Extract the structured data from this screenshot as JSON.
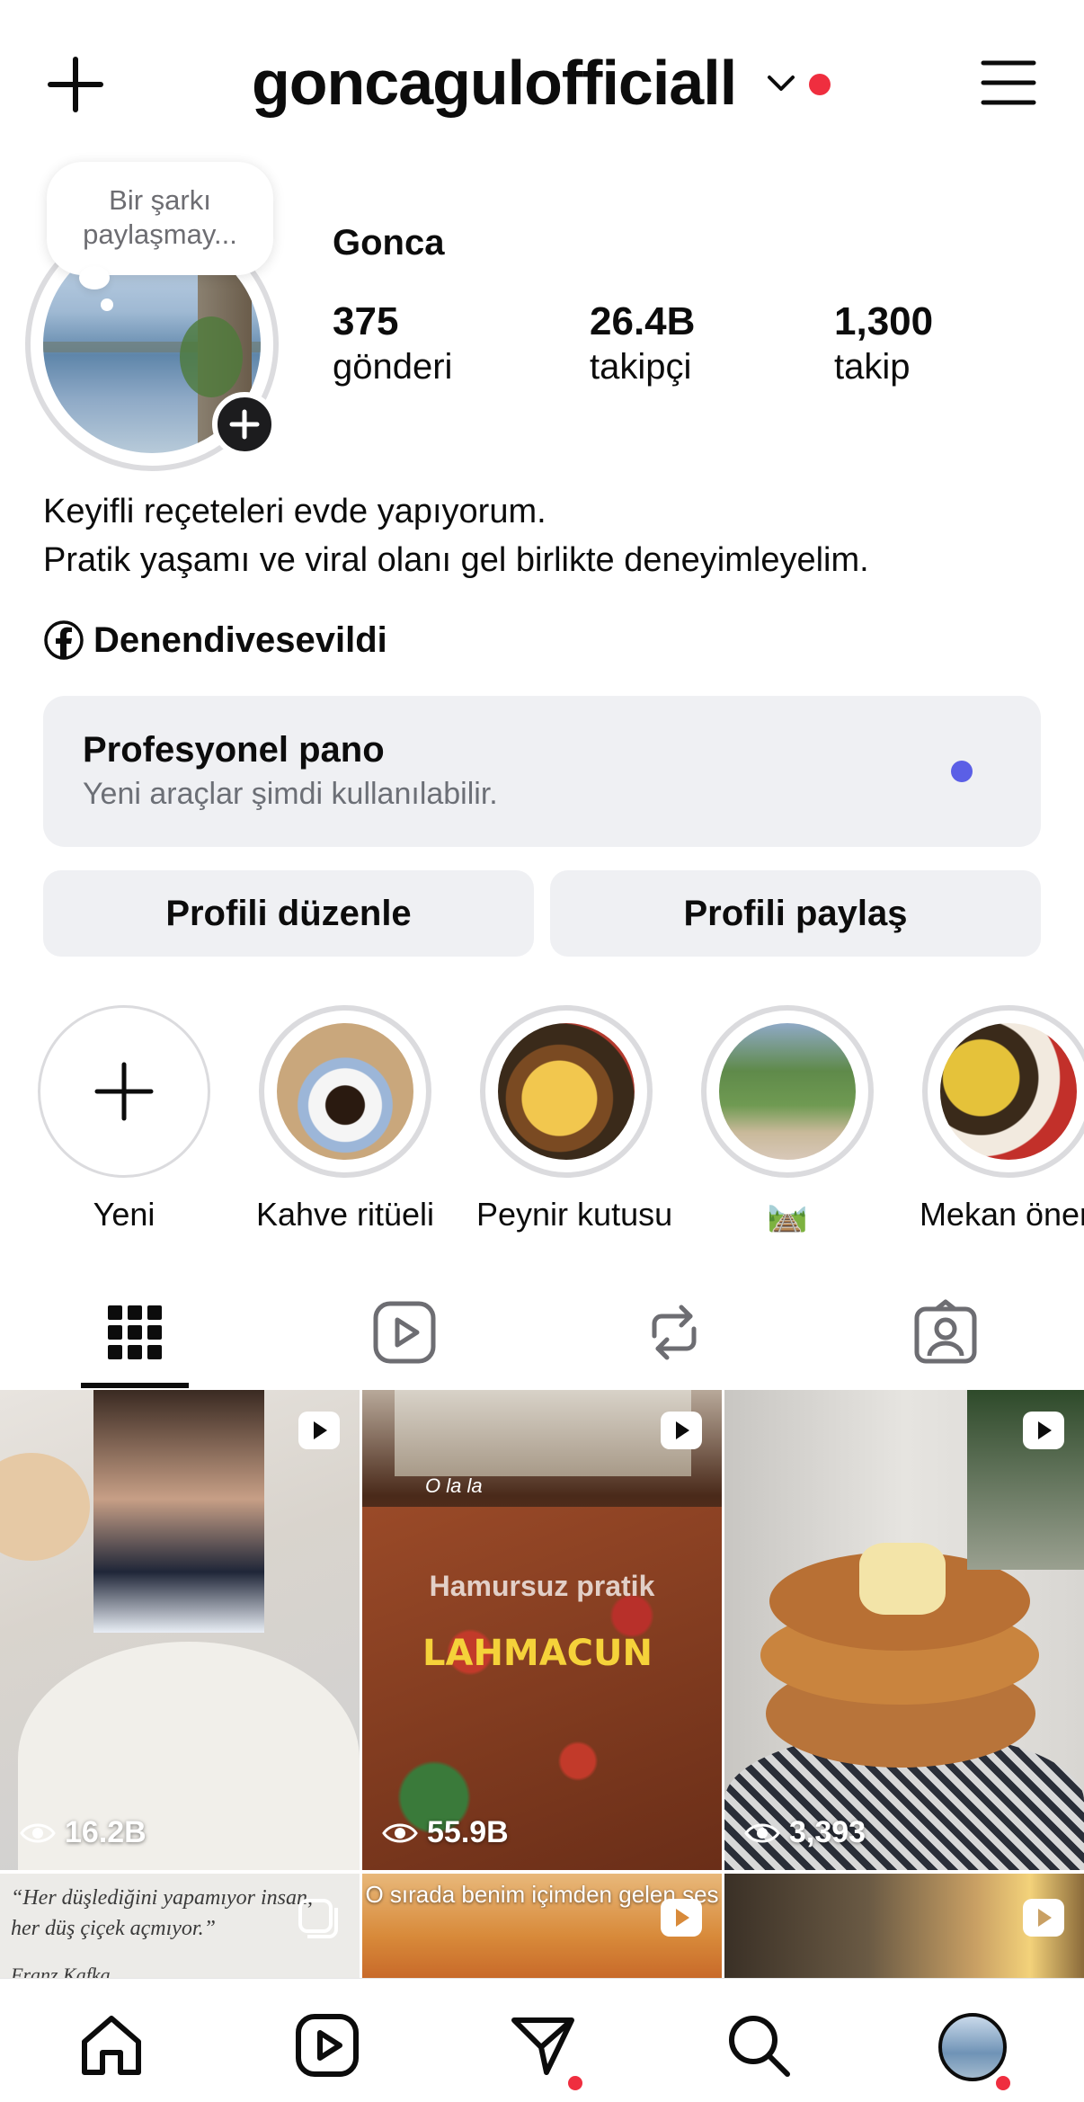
{
  "header": {
    "username": "goncagulofficiall",
    "notification_color": "#ef2e3f"
  },
  "profile": {
    "note_bubble": "Bir şarkı paylaşmay...",
    "full_name": "Gonca",
    "stats": [
      {
        "value": "375",
        "label": "gönderi"
      },
      {
        "value": "26.4B",
        "label": "takipçi"
      },
      {
        "value": "1,300",
        "label": "takip"
      }
    ],
    "bio_lines": [
      "Keyifli reçeteleri evde yapıyorum.",
      "Pratik yaşamı ve viral olanı gel birlikte deneyimleyelim."
    ],
    "facebook_link": "Denendivesevildi"
  },
  "pro_dashboard": {
    "title": "Profesyonel pano",
    "subtitle": "Yeni araçlar şimdi kullanılabilir.",
    "dot_color": "#5b5fe6"
  },
  "buttons": {
    "edit": "Profili düzenle",
    "share": "Profili paylaş"
  },
  "highlights": [
    {
      "label": "Yeni",
      "icon": "plus-icon"
    },
    {
      "label": "Kahve ritüeli"
    },
    {
      "label": "Peynir kutusu"
    },
    {
      "label": "🛤️"
    },
    {
      "label": "Mekan öneri"
    }
  ],
  "tabs": [
    {
      "icon": "grid-icon",
      "active": true
    },
    {
      "icon": "reels-icon"
    },
    {
      "icon": "reposts-icon"
    },
    {
      "icon": "tagged-icon"
    }
  ],
  "posts": [
    {
      "views": "16.2B",
      "type": "reel"
    },
    {
      "views": "55.9B",
      "type": "reel",
      "overlay_top": "O la la",
      "overlay_mid": "Hamursuz pratik",
      "overlay_main": "LAHMACUN"
    },
    {
      "views": "3,393",
      "type": "reel"
    },
    {
      "type": "carousel",
      "quote_line1": "“Her düşlediğini yapamıyor insan,",
      "quote_line2": "her düş çiçek açmıyor.”",
      "quote_author": "Franz Kafka"
    },
    {
      "type": "reel",
      "caption": "O sırada benim içimden gelen ses"
    },
    {
      "type": "reel"
    }
  ],
  "bottom_nav": [
    {
      "icon": "home-icon"
    },
    {
      "icon": "reels-icon"
    },
    {
      "icon": "messages-icon",
      "dot": true
    },
    {
      "icon": "search-icon"
    },
    {
      "icon": "profile-avatar",
      "dot": true
    }
  ]
}
